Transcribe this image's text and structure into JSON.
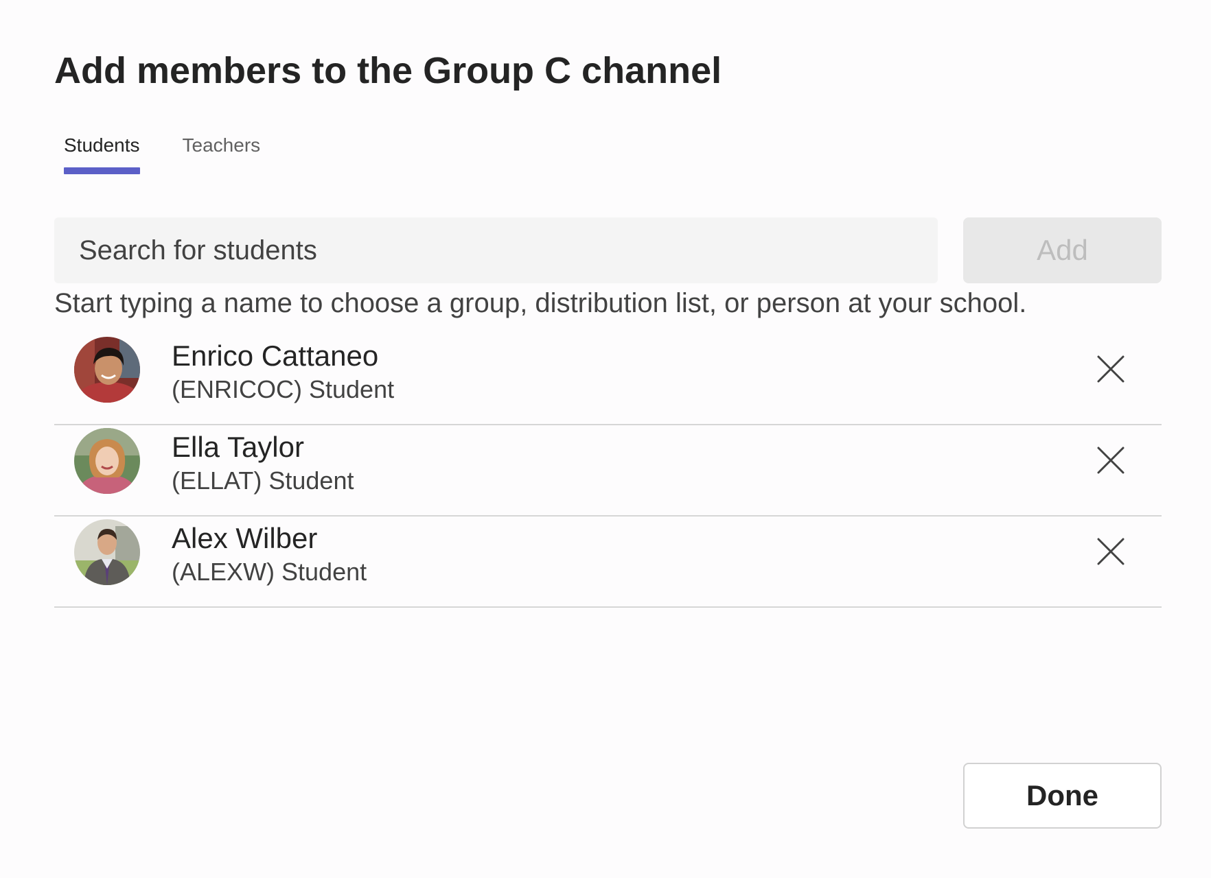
{
  "dialog": {
    "title": "Add members to the Group C channel"
  },
  "tabs": [
    {
      "label": "Students",
      "active": true
    },
    {
      "label": "Teachers",
      "active": false
    }
  ],
  "search": {
    "placeholder": "Search for students",
    "value": ""
  },
  "add_button": {
    "label": "Add",
    "enabled": false
  },
  "hint": "Start typing a name to choose a group, distribution list, or person at your school.",
  "members": [
    {
      "name": "Enrico Cattaneo",
      "subtitle": "(ENRICOC) Student",
      "remove_icon": "close-icon"
    },
    {
      "name": "Ella Taylor",
      "subtitle": "(ELLAT) Student",
      "remove_icon": "close-icon"
    },
    {
      "name": "Alex Wilber",
      "subtitle": "(ALEXW) Student",
      "remove_icon": "close-icon"
    }
  ],
  "done_button": {
    "label": "Done"
  },
  "colors": {
    "accent": "#5b5fc7",
    "search_bg": "#f4f4f4",
    "disabled_button_bg": "#e8e8e8",
    "divider": "#d6d6d6"
  }
}
